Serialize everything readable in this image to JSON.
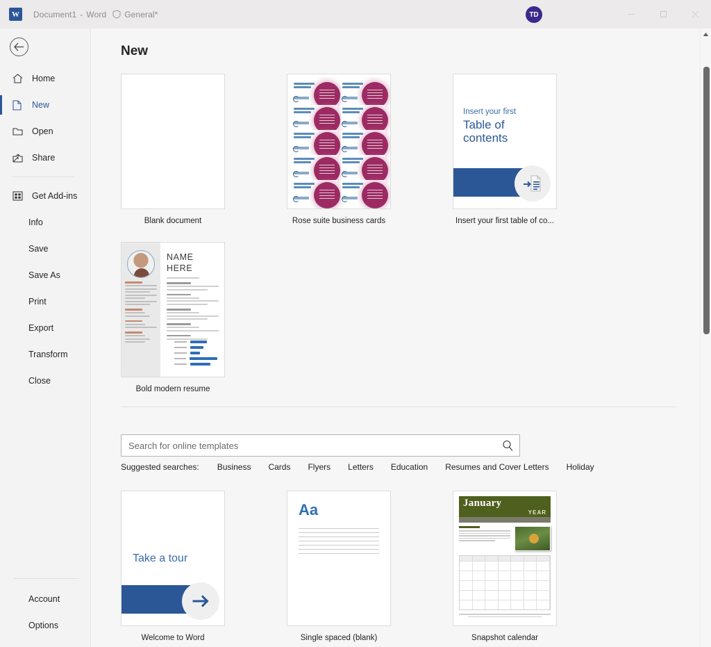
{
  "titlebar": {
    "app_icon": "word-logo-icon",
    "document_name": "Document1",
    "separator": "-",
    "app_name": "Word",
    "sensitivity_icon": "shield-icon",
    "sensitivity_label": "General*",
    "avatar_initials": "TD",
    "minimize_label": "Minimize",
    "maximize_label": "Maximize",
    "close_label": "Close"
  },
  "sidebar": {
    "back_label": "Back",
    "items": [
      {
        "label": "Home",
        "icon": "home-icon",
        "selected": false
      },
      {
        "label": "New",
        "icon": "new-document-icon",
        "selected": true
      },
      {
        "label": "Open",
        "icon": "folder-open-icon",
        "selected": false
      },
      {
        "label": "Share",
        "icon": "share-icon",
        "selected": false
      },
      {
        "label": "Get Add-ins",
        "icon": "add-ins-icon",
        "selected": false
      },
      {
        "label": "Info",
        "icon": "",
        "selected": false
      },
      {
        "label": "Save",
        "icon": "",
        "selected": false
      },
      {
        "label": "Save As",
        "icon": "",
        "selected": false
      },
      {
        "label": "Print",
        "icon": "",
        "selected": false
      },
      {
        "label": "Export",
        "icon": "",
        "selected": false
      },
      {
        "label": "Transform",
        "icon": "",
        "selected": false
      },
      {
        "label": "Close",
        "icon": "",
        "selected": false
      }
    ],
    "bottom_items": [
      {
        "label": "Account"
      },
      {
        "label": "Options"
      }
    ]
  },
  "main": {
    "page_title": "New",
    "featured_templates": [
      {
        "caption": "Blank document",
        "kind": "blank"
      },
      {
        "caption": "Rose suite business cards",
        "kind": "cards"
      },
      {
        "caption": "Insert your first table of co...",
        "kind": "toc",
        "preview_line1": "Insert your first",
        "preview_line2": "Table of",
        "preview_line3": "contents"
      },
      {
        "caption": "Bold modern resume",
        "kind": "resume",
        "preview_line1": "NAME",
        "preview_line2": "HERE"
      }
    ],
    "search": {
      "placeholder": "Search for online templates",
      "value": "",
      "icon": "search-icon"
    },
    "suggested": {
      "label": "Suggested searches:",
      "items": [
        "Business",
        "Cards",
        "Flyers",
        "Letters",
        "Education",
        "Resumes and Cover Letters",
        "Holiday"
      ]
    },
    "online_templates": [
      {
        "caption": "Welcome to Word",
        "kind": "tour",
        "preview_text": "Take a tour"
      },
      {
        "caption": "Single spaced (blank)",
        "kind": "single",
        "preview_text": "Aa"
      },
      {
        "caption": "Snapshot calendar",
        "kind": "calendar",
        "month": "January",
        "year_label": "YEAR"
      }
    ]
  },
  "scrollbar": {
    "up_arrow": "scroll-up-icon"
  },
  "colors": {
    "accent": "#2b579a",
    "band_blue": "#2b5797",
    "rose": "#9c2b63",
    "olive": "#4e5f1e",
    "avatar": "#3b2a8c"
  }
}
